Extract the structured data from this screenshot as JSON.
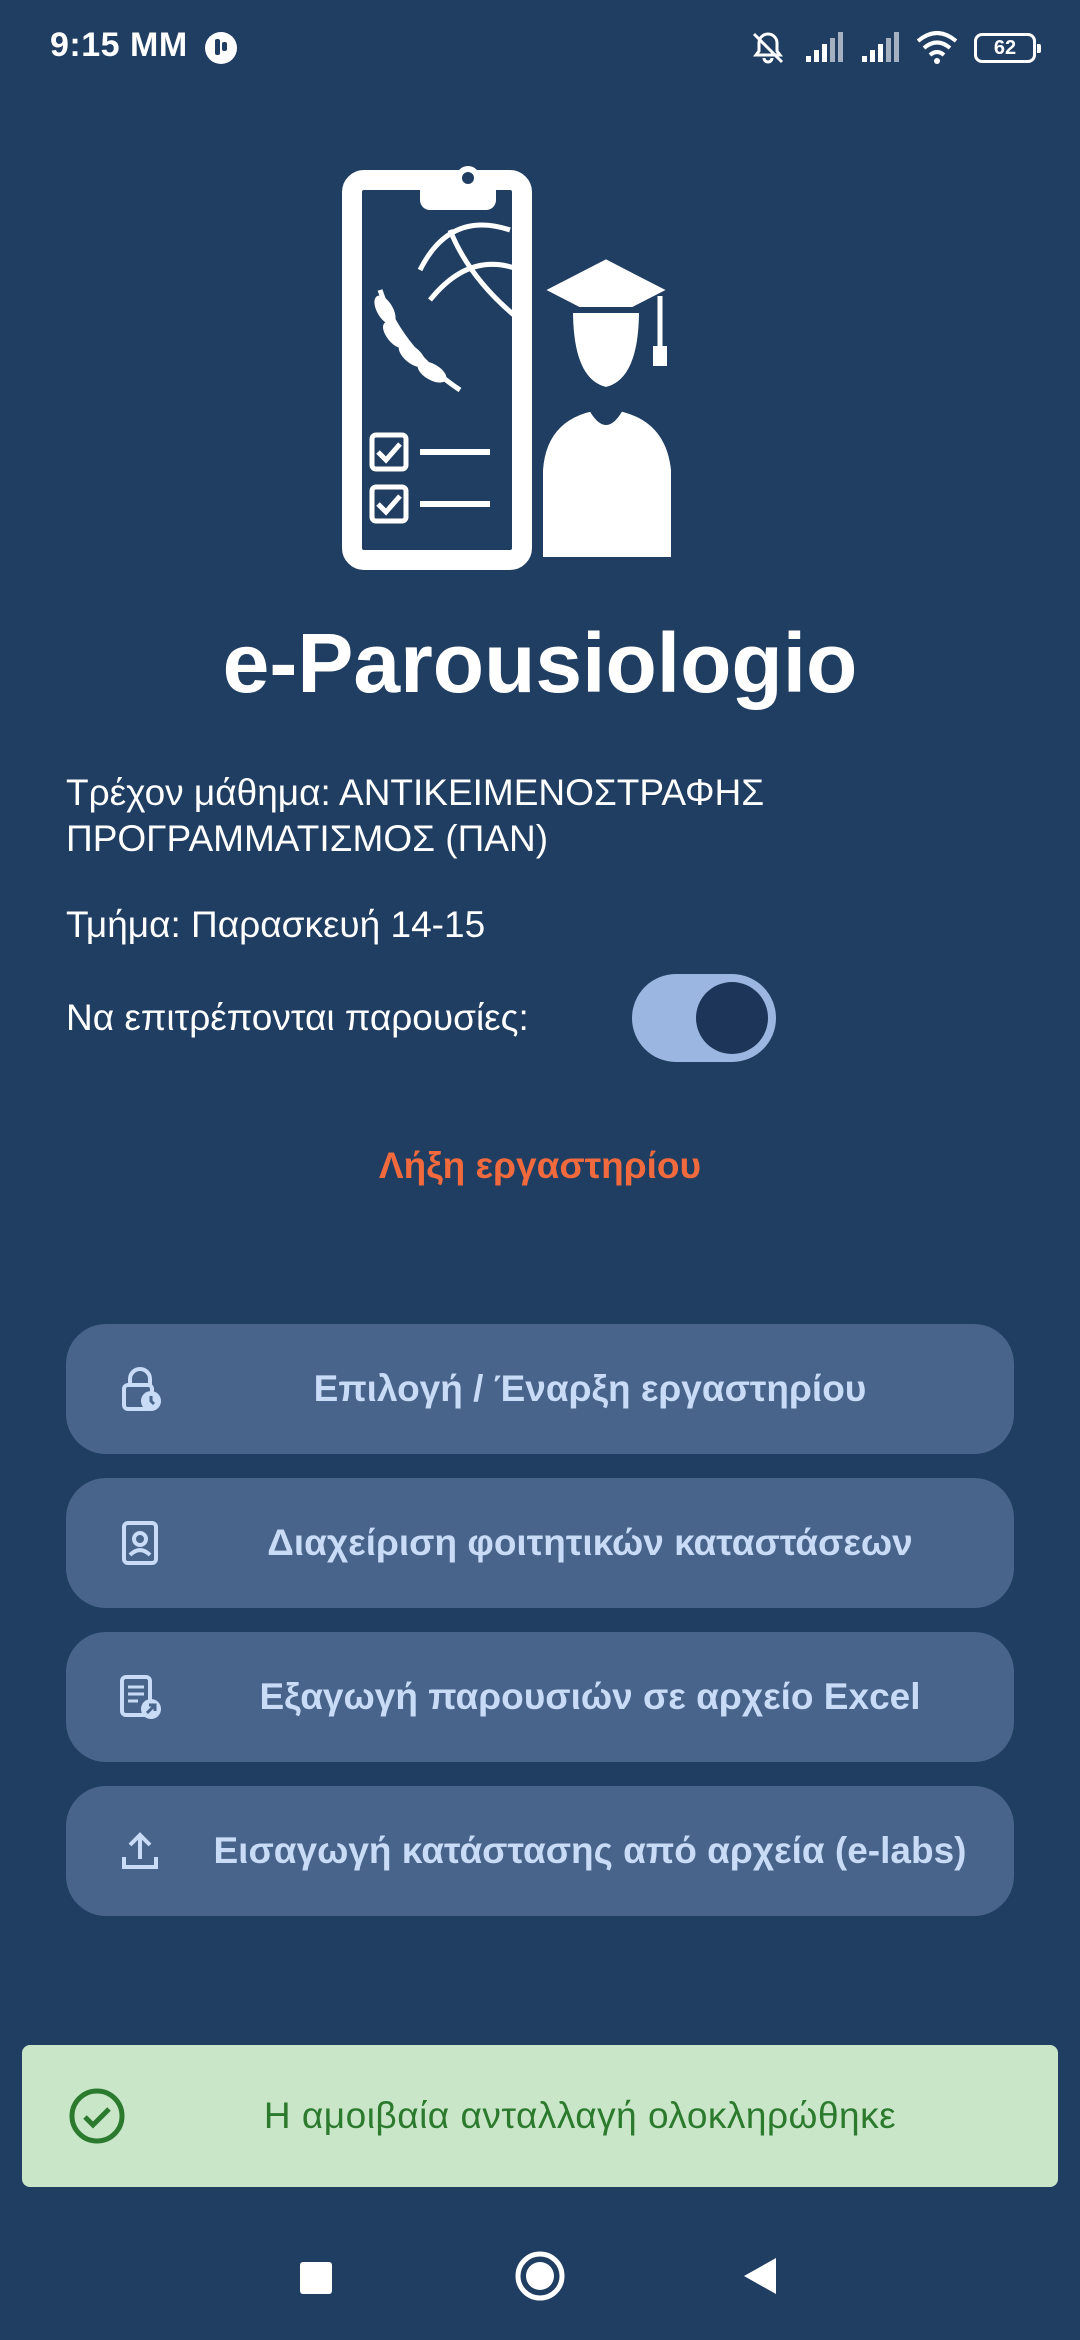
{
  "status_bar": {
    "time": "9:15 MM",
    "battery": "62",
    "icons": [
      "app-notification-icon",
      "bell-off-icon",
      "signal-icon",
      "signal-icon",
      "wifi-icon",
      "battery-icon"
    ]
  },
  "app": {
    "title": "e-Parousiologio",
    "logo_icon": "clipboard-graduate-logo"
  },
  "info": {
    "current_course": "Τρέχον μάθημα: ΑΝΤΙΚΕΙΜΕΝΟΣΤΡΑΦΗΣ ΠΡΟΓΡΑΜΜΑΤΙΣΜΟΣ (ΠΑΝ)",
    "section": "Τμήμα: Παρασκευή 14-15",
    "allow_attendance_label": "Να επιτρέπονται παρουσίες:",
    "allow_attendance_on": true
  },
  "end_lab_label": "Λήξη εργαστηρίου",
  "actions": [
    {
      "label": "Επιλογή / Έναρξη εργαστηρίου",
      "icon": "lock-clock-icon"
    },
    {
      "label": "Διαχείριση φοιτητικών καταστάσεων",
      "icon": "student-badge-icon"
    },
    {
      "label": "Εξαγωγή παρουσιών σε αρχείο Excel",
      "icon": "document-export-icon"
    },
    {
      "label": "Εισαγωγή κατάστασης από αρχεία (e-labs)",
      "icon": "upload-icon"
    }
  ],
  "snackbar": {
    "message": "Η αμοιβαία ανταλλαγή ολοκληρώθηκε",
    "icon": "check-circle-icon"
  },
  "colors": {
    "background": "#203d62",
    "button_bg": "#48648a",
    "button_text": "#c8dbf7",
    "end_lab": "#f06a3d",
    "toggle_track": "#9bb6e0",
    "snackbar_bg": "#c9e6c8",
    "snackbar_text": "#2b7a2e"
  },
  "nav_bar": {
    "buttons": [
      "recents-icon",
      "home-icon",
      "back-icon"
    ]
  }
}
